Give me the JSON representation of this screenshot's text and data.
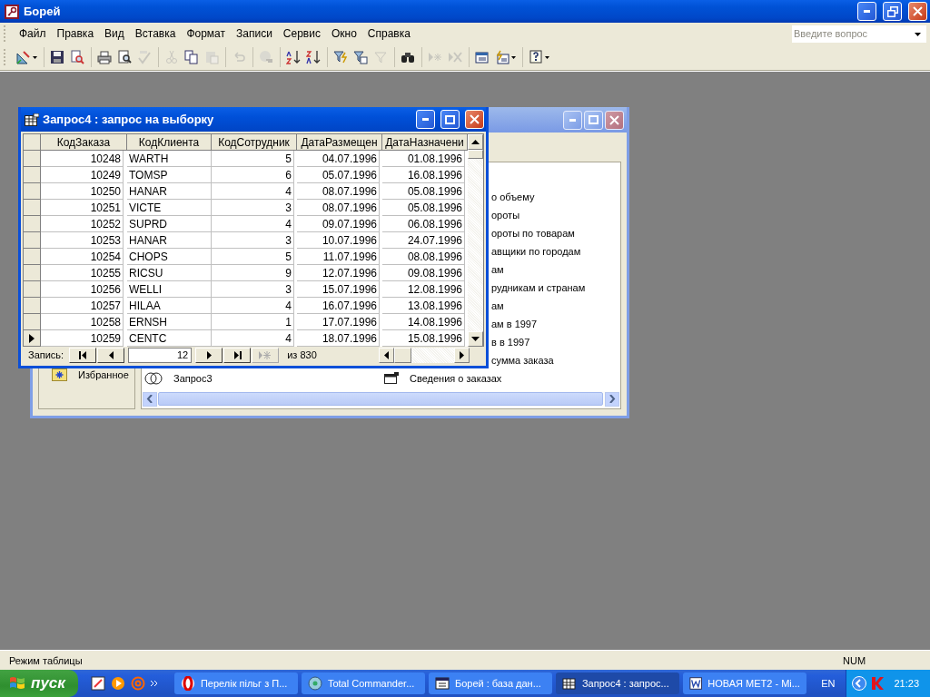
{
  "app": {
    "title": "Борей"
  },
  "menu": [
    {
      "label": "Файл"
    },
    {
      "label": "Правка"
    },
    {
      "label": "Вид"
    },
    {
      "label": "Вставка"
    },
    {
      "label": "Формат"
    },
    {
      "label": "Записи"
    },
    {
      "label": "Сервис"
    },
    {
      "label": "Окно"
    },
    {
      "label": "Справка"
    }
  ],
  "help_box": {
    "placeholder": "Введите вопрос"
  },
  "toolbar": [
    {
      "kind": "design",
      "disabled": false,
      "dropdown": true,
      "separator_before": false
    },
    {
      "kind": "save",
      "disabled": false,
      "dropdown": false,
      "separator_before": true
    },
    {
      "kind": "file-search",
      "disabled": false,
      "dropdown": false,
      "separator_before": false
    },
    {
      "kind": "print",
      "disabled": false,
      "dropdown": false,
      "separator_before": true
    },
    {
      "kind": "preview",
      "disabled": false,
      "dropdown": false,
      "separator_before": false
    },
    {
      "kind": "spelling",
      "disabled": true,
      "dropdown": false,
      "separator_before": false
    },
    {
      "kind": "cut",
      "disabled": true,
      "dropdown": false,
      "separator_before": true
    },
    {
      "kind": "copy",
      "disabled": false,
      "dropdown": false,
      "separator_before": false
    },
    {
      "kind": "paste",
      "disabled": true,
      "dropdown": false,
      "separator_before": false
    },
    {
      "kind": "undo",
      "disabled": true,
      "dropdown": false,
      "separator_before": true
    },
    {
      "kind": "hyperlink",
      "disabled": true,
      "dropdown": false,
      "separator_before": true
    },
    {
      "kind": "sort-asc",
      "disabled": false,
      "dropdown": false,
      "separator_before": true
    },
    {
      "kind": "sort-desc",
      "disabled": false,
      "dropdown": false,
      "separator_before": false
    },
    {
      "kind": "filter-selection",
      "disabled": false,
      "dropdown": false,
      "separator_before": true
    },
    {
      "kind": "filter-form",
      "disabled": false,
      "dropdown": false,
      "separator_before": false
    },
    {
      "kind": "filter",
      "disabled": true,
      "dropdown": false,
      "separator_before": false
    },
    {
      "kind": "find",
      "disabled": false,
      "dropdown": false,
      "separator_before": true
    },
    {
      "kind": "new-record",
      "disabled": true,
      "dropdown": false,
      "separator_before": true
    },
    {
      "kind": "delete-record",
      "disabled": true,
      "dropdown": false,
      "separator_before": false
    },
    {
      "kind": "database-window",
      "disabled": false,
      "dropdown": false,
      "separator_before": true
    },
    {
      "kind": "new-object",
      "disabled": false,
      "dropdown": true,
      "separator_before": false
    },
    {
      "kind": "help",
      "disabled": false,
      "dropdown": true,
      "separator_before": true
    }
  ],
  "database_window": {
    "favorites": "Избранное",
    "column_1": [
      {
        "label": "Запрос3",
        "kind": "query"
      }
    ],
    "column_2": [
      {
        "label": "о объему"
      },
      {
        "label": "ороты"
      },
      {
        "label": "ороты по товарам"
      },
      {
        "label": "авщики по городам"
      },
      {
        "label": "ам"
      },
      {
        "label": "рудникам и странам"
      },
      {
        "label": "ам"
      },
      {
        "label": "ам в 1997"
      },
      {
        "label": "в в 1997"
      },
      {
        "label": "сумма заказа"
      },
      {
        "label": "Сведения о заказах",
        "kind": "form"
      }
    ]
  },
  "query_window": {
    "title": "Запрос4 : запрос на выборку",
    "columns": [
      "КодЗаказа",
      "КодКлиента",
      "КодСотрудник",
      "ДатаРазмещен",
      "ДатаНазначени"
    ],
    "rows": [
      {
        "cells": [
          "10248",
          "WARTH",
          "5",
          "04.07.1996",
          "01.08.1996"
        ],
        "current": false
      },
      {
        "cells": [
          "10249",
          "TOMSP",
          "6",
          "05.07.1996",
          "16.08.1996"
        ],
        "current": false
      },
      {
        "cells": [
          "10250",
          "HANAR",
          "4",
          "08.07.1996",
          "05.08.1996"
        ],
        "current": false
      },
      {
        "cells": [
          "10251",
          "VICTE",
          "3",
          "08.07.1996",
          "05.08.1996"
        ],
        "current": false
      },
      {
        "cells": [
          "10252",
          "SUPRD",
          "4",
          "09.07.1996",
          "06.08.1996"
        ],
        "current": false
      },
      {
        "cells": [
          "10253",
          "HANAR",
          "3",
          "10.07.1996",
          "24.07.1996"
        ],
        "current": false
      },
      {
        "cells": [
          "10254",
          "CHOPS",
          "5",
          "11.07.1996",
          "08.08.1996"
        ],
        "current": false
      },
      {
        "cells": [
          "10255",
          "RICSU",
          "9",
          "12.07.1996",
          "09.08.1996"
        ],
        "current": false
      },
      {
        "cells": [
          "10256",
          "WELLI",
          "3",
          "15.07.1996",
          "12.08.1996"
        ],
        "current": false
      },
      {
        "cells": [
          "10257",
          "HILAA",
          "4",
          "16.07.1996",
          "13.08.1996"
        ],
        "current": false
      },
      {
        "cells": [
          "10258",
          "ERNSH",
          "1",
          "17.07.1996",
          "14.08.1996"
        ],
        "current": false
      },
      {
        "cells": [
          "10259",
          "CENTC",
          "4",
          "18.07.1996",
          "15.08.1996"
        ],
        "current": true
      }
    ],
    "navigator": {
      "label": "Запись:",
      "record": "12",
      "total": "из 830"
    }
  },
  "status_bar": {
    "mode": "Режим таблицы",
    "indicator": "NUM"
  },
  "taskbar": {
    "start": "пуск",
    "tasks": [
      {
        "label": "Перелік пільг з П...",
        "kind": "browser",
        "selected": false
      },
      {
        "label": "Total Commander...",
        "kind": "files",
        "selected": false
      },
      {
        "label": "Борей : база дан...",
        "kind": "database",
        "selected": false
      },
      {
        "label": "Запрос4 : запрос...",
        "kind": "query",
        "selected": true
      },
      {
        "label": "НОВАЯ МЕТ2 - Mi...",
        "kind": "document",
        "selected": false
      }
    ],
    "language": "EN",
    "clock": "21:23"
  }
}
